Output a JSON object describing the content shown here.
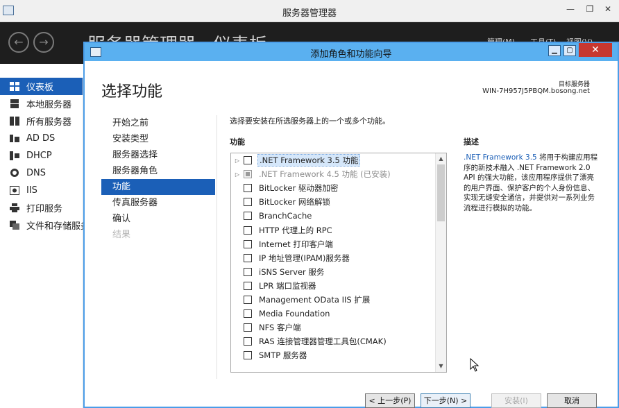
{
  "server_manager": {
    "title": "服务器管理器",
    "header_title": "服务器管理器 · 仪表板",
    "header_menu": [
      "管理(M)",
      "工具(T)",
      "视图(V)",
      "帮助(H)"
    ],
    "sidebar": [
      {
        "label": "仪表板",
        "icon": "dashboard-icon",
        "active": true
      },
      {
        "label": "本地服务器",
        "icon": "server-icon"
      },
      {
        "label": "所有服务器",
        "icon": "servers-icon"
      },
      {
        "label": "AD DS",
        "icon": "ad-ds-icon"
      },
      {
        "label": "DHCP",
        "icon": "dhcp-icon"
      },
      {
        "label": "DNS",
        "icon": "dns-icon"
      },
      {
        "label": "IIS",
        "icon": "iis-icon"
      },
      {
        "label": "打印服务",
        "icon": "print-icon"
      },
      {
        "label": "文件和存储服务",
        "icon": "storage-icon"
      }
    ]
  },
  "wizard": {
    "title": "添加角色和功能向导",
    "heading": "选择功能",
    "destination_label": "目标服务器",
    "destination_server": "WIN-7H957J5PBQM.bosong.net",
    "steps": [
      {
        "label": "开始之前",
        "state": "normal"
      },
      {
        "label": "安装类型",
        "state": "normal"
      },
      {
        "label": "服务器选择",
        "state": "normal"
      },
      {
        "label": "服务器角色",
        "state": "normal"
      },
      {
        "label": "功能",
        "state": "active"
      },
      {
        "label": "传真服务器",
        "state": "normal"
      },
      {
        "label": "确认",
        "state": "normal"
      },
      {
        "label": "结果",
        "state": "disabled"
      }
    ],
    "intro": "选择要安装在所选服务器上的一个或多个功能。",
    "features_label": "功能",
    "description_label": "描述",
    "features": [
      {
        "label": ".NET Framework 3.5 功能",
        "expandable": true,
        "selected": true,
        "installed": false
      },
      {
        "label": ".NET Framework 4.5 功能 (已安装)",
        "expandable": true,
        "selected": false,
        "installed": true
      },
      {
        "label": "BitLocker 驱动器加密",
        "expandable": false,
        "selected": false,
        "installed": false
      },
      {
        "label": "BitLocker 网络解锁",
        "expandable": false,
        "selected": false,
        "installed": false
      },
      {
        "label": "BranchCache",
        "expandable": false,
        "selected": false,
        "installed": false
      },
      {
        "label": "HTTP 代理上的 RPC",
        "expandable": false,
        "selected": false,
        "installed": false
      },
      {
        "label": "Internet 打印客户端",
        "expandable": false,
        "selected": false,
        "installed": false
      },
      {
        "label": "IP 地址管理(IPAM)服务器",
        "expandable": false,
        "selected": false,
        "installed": false
      },
      {
        "label": "iSNS Server 服务",
        "expandable": false,
        "selected": false,
        "installed": false
      },
      {
        "label": "LPR 端口监视器",
        "expandable": false,
        "selected": false,
        "installed": false
      },
      {
        "label": "Management OData IIS 扩展",
        "expandable": false,
        "selected": false,
        "installed": false
      },
      {
        "label": "Media Foundation",
        "expandable": false,
        "selected": false,
        "installed": false
      },
      {
        "label": "NFS 客户端",
        "expandable": false,
        "selected": false,
        "installed": false
      },
      {
        "label": "RAS 连接管理器管理工具包(CMAK)",
        "expandable": false,
        "selected": false,
        "installed": false
      },
      {
        "label": "SMTP 服务器",
        "expandable": false,
        "selected": false,
        "installed": false
      }
    ],
    "description_lead": ".NET Framework 3.5",
    "description_rest": " 将用于构建应用程序的新技术融入 .NET Framework 2.0 API 的强大功能，该应用程序提供了漂亮的用户界面、保护客户的个人身份信息、实现无缝安全通信，并提供对一系列业务流程进行模拟的功能。",
    "buttons": {
      "previous": "< 上一步(P)",
      "next": "下一步(N) >",
      "install": "安装(I)",
      "cancel": "取消"
    }
  },
  "colors": {
    "accent": "#1b5fb7",
    "titlebar": "#5ab0f0",
    "close": "#c7372f",
    "header_bg": "#1e1e1e"
  }
}
